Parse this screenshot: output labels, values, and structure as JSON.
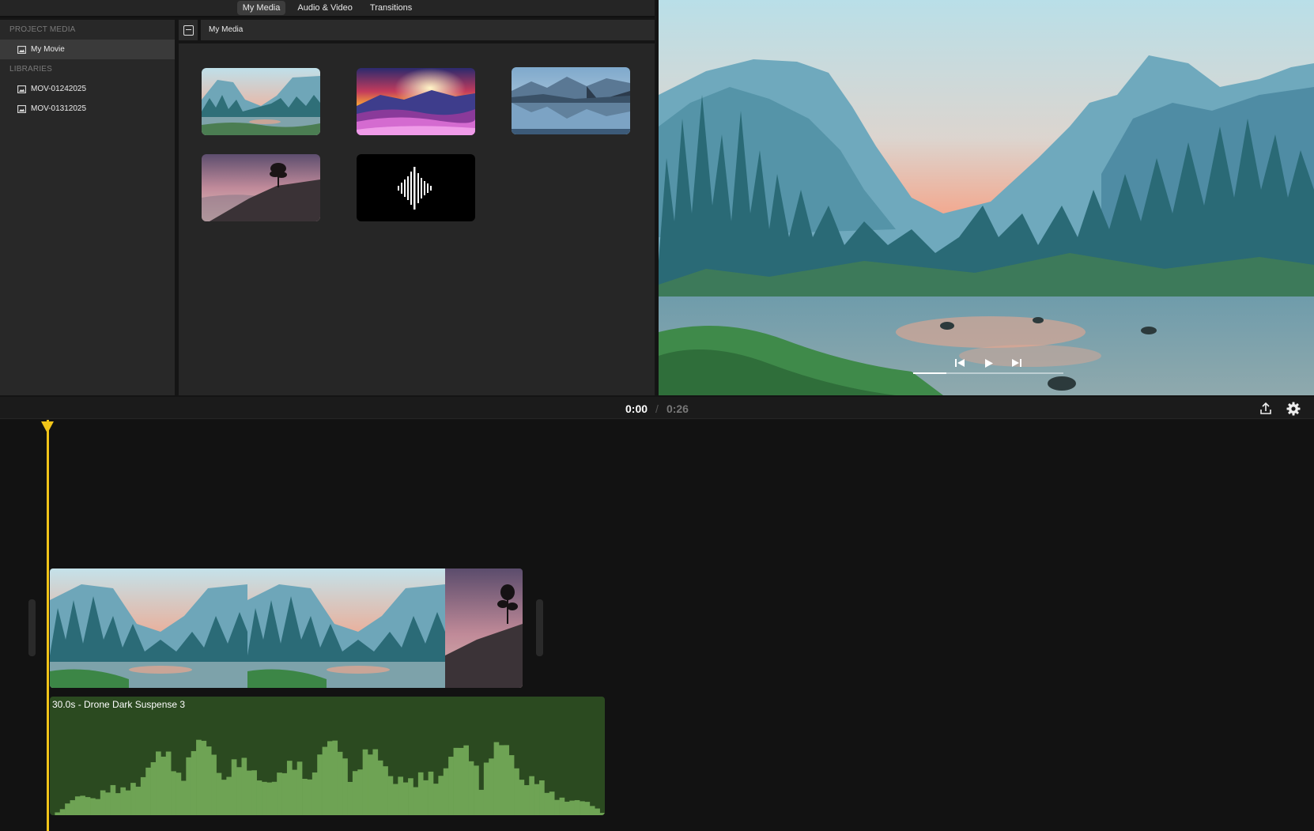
{
  "tabs": [
    {
      "label": "My Media",
      "active": true
    },
    {
      "label": "Audio & Video",
      "active": false
    },
    {
      "label": "Transitions",
      "active": false
    }
  ],
  "sidebar": {
    "project_section": "PROJECT MEDIA",
    "project_items": [
      {
        "label": "My Movie",
        "icon": "image-icon",
        "selected": true
      }
    ],
    "libraries_section": "LIBRARIES",
    "library_items": [
      {
        "label": "MOV-01242025",
        "icon": "image-icon"
      },
      {
        "label": "MOV-01312025",
        "icon": "image-icon"
      }
    ]
  },
  "media_panel": {
    "title": "My Media",
    "items": [
      {
        "type": "image",
        "subject": "valley-river"
      },
      {
        "type": "image",
        "subject": "flower-sunset"
      },
      {
        "type": "image",
        "subject": "mountain-lake"
      },
      {
        "type": "image",
        "subject": "lone-tree-dusk"
      },
      {
        "type": "audio",
        "subject": "waveform-icon"
      }
    ]
  },
  "playback": {
    "current": "0:00",
    "separator": "/",
    "total": "0:26",
    "progress": 0.22
  },
  "toolbar_icons": [
    "share-icon",
    "gear-icon"
  ],
  "timeline": {
    "audio_clip_label": "30.0s - Drone Dark Suspense 3",
    "accent_color": "#f0c419",
    "audio_color": "#2b4a20"
  }
}
